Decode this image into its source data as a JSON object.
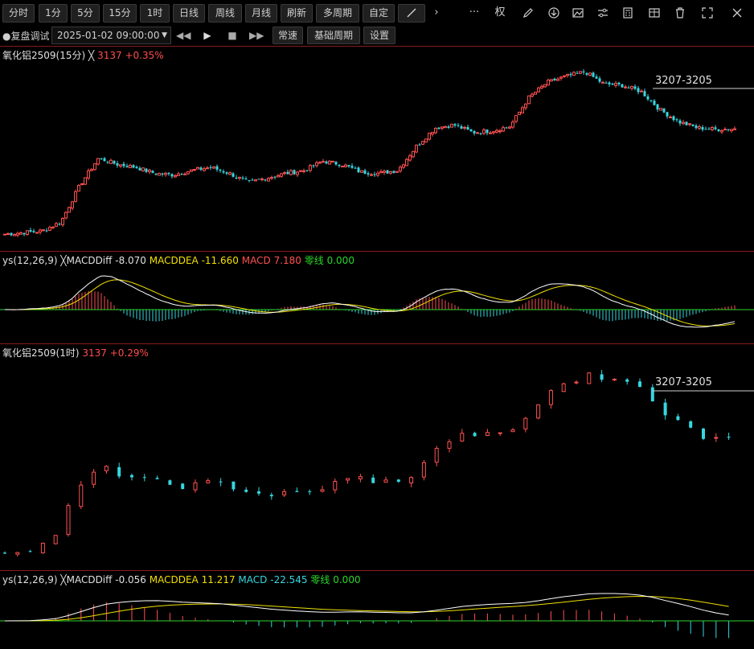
{
  "toolbar": {
    "periods": [
      "分时",
      "1分",
      "5分",
      "15分",
      "1时",
      "日线",
      "周线",
      "月线",
      "刷新",
      "多周期",
      "自定"
    ],
    "more_icon": "chevron-right-icon",
    "dots": "···",
    "quan": "权"
  },
  "replay": {
    "label": "●复盘调试",
    "datetime": "2025-01-02 09:00:00",
    "speed": "常速",
    "base_period": "基础周期",
    "settings": "设置"
  },
  "panel15m": {
    "name": "氧化铝2509(15分)",
    "price": "3137",
    "change": "+0.35%",
    "level": "3207-3205"
  },
  "macd15m": {
    "prefix": "ys(12,26,9)",
    "diff_label": "MACDDiff",
    "diff_value": "-8.070",
    "dea_label": "MACDDEA",
    "dea_value": "-11.660",
    "macd_label": "MACD",
    "macd_value": "7.180",
    "zero_label": "零线",
    "zero_value": "0.000"
  },
  "panel1h": {
    "name": "氧化铝2509(1时)",
    "price": "3137",
    "change": "+0.29%",
    "level": "3207-3205"
  },
  "macd1h": {
    "prefix": "ys(12,26,9)",
    "diff_label": "MACDDiff",
    "diff_value": "-0.056",
    "dea_label": "MACDDEA",
    "dea_value": "11.217",
    "macd_label": "MACD",
    "macd_value": "-22.545",
    "zero_label": "零线",
    "zero_value": "0.000"
  },
  "colors": {
    "up": "#ff5050",
    "down": "#36d7e0",
    "diff_line": "#ffffff",
    "dea_line": "#f0e000",
    "zero_line": "#2bd62b",
    "panel_border": "#8a1a1a"
  },
  "chart_data": [
    {
      "type": "candlestick",
      "title": "氧化铝2509(15分)",
      "price_trend": [
        2790,
        2795,
        2800,
        2830,
        2950,
        3040,
        3020,
        3010,
        2990,
        2985,
        3000,
        3010,
        2990,
        2960,
        2975,
        2990,
        3000,
        3030,
        3020,
        2995,
        2990,
        3000,
        3080,
        3140,
        3150,
        3125,
        3130,
        3145,
        3240,
        3290,
        3310,
        3325,
        3285,
        3280,
        3260,
        3200,
        3160,
        3140,
        3135,
        3137
      ]
    },
    {
      "type": "candlestick",
      "title": "氧化铝2509(1时)",
      "price_trend": [
        2790,
        2800,
        2820,
        2960,
        3040,
        3020,
        3000,
        2990,
        2985,
        2995,
        2980,
        2960,
        2960,
        2965,
        2990,
        3010,
        3000,
        2990,
        3060,
        3120,
        3140,
        3130,
        3160,
        3240,
        3290,
        3310,
        3300,
        3305,
        3200,
        3170,
        3130,
        3137
      ]
    }
  ]
}
